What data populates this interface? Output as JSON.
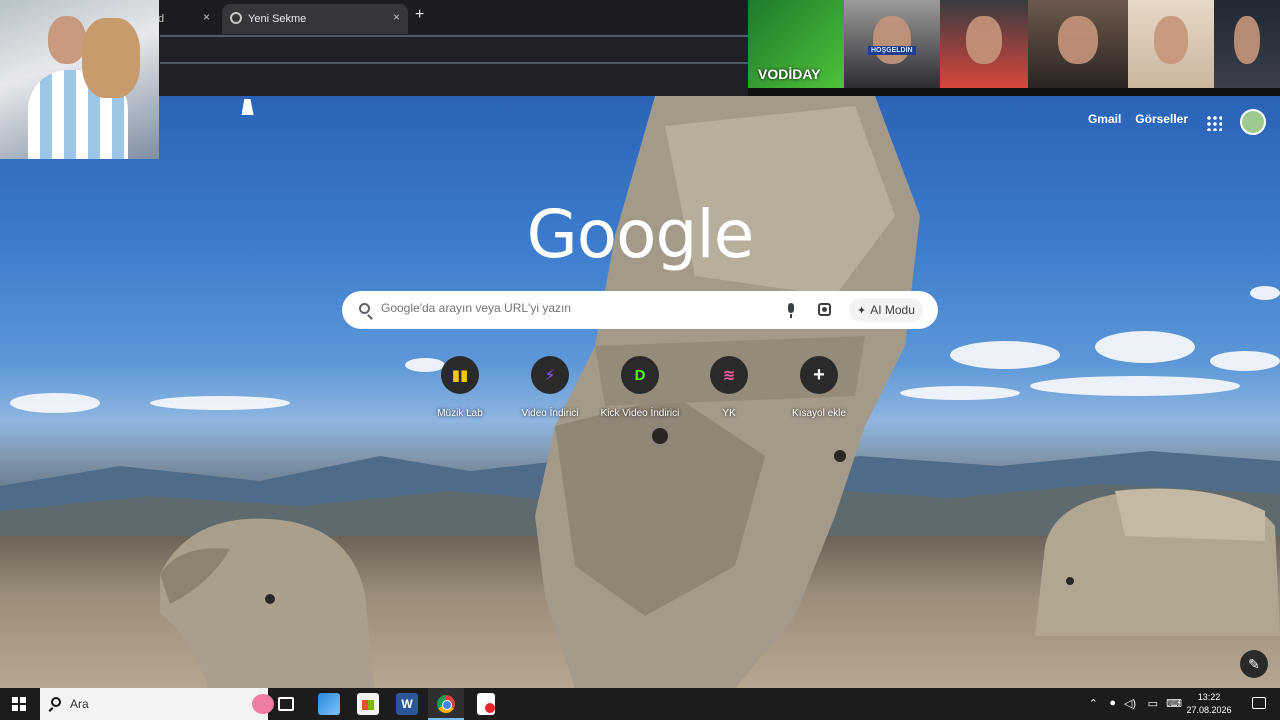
{
  "browser": {
    "tabs": [
      {
        "title": "d"
      },
      {
        "title": "Yeni Sekme"
      }
    ],
    "new_tab_label": "+",
    "close_glyph": "×"
  },
  "overlays": {
    "streamer_label": "VODİDAY",
    "banner_label": "HOŞGELDİN"
  },
  "google": {
    "header_links": [
      "Gmail",
      "Görseller"
    ],
    "logo": "Google",
    "search_placeholder": "Google'da arayın veya URL'yi yazın",
    "ai_mode_label": "AI Modu",
    "shortcuts": [
      {
        "label": "Müzik Lab",
        "glyph": "▮▮",
        "icon_color": "#f5c518",
        "icon": "music-lab-icon"
      },
      {
        "label": "Video İndirici",
        "glyph": "⚡",
        "icon_color": "#9b59ff",
        "icon": "lightning-icon"
      },
      {
        "label": "Kick Video İndirici",
        "glyph": "D",
        "icon_color": "#53fc18",
        "icon": "kick-icon"
      },
      {
        "label": "YK",
        "glyph": "≋",
        "icon_color": "#ff5fa2",
        "icon": "yk-icon"
      },
      {
        "label": "Kısayol ekle",
        "glyph": "+",
        "icon_color": "#ffffff",
        "icon": "add-icon"
      }
    ]
  },
  "taskbar": {
    "search_text": "Ara",
    "word_glyph": "W",
    "time": "13:22",
    "date": "27.08.2026",
    "tray_icons": [
      "chevron-up-icon",
      "microphone-icon",
      "speaker-icon",
      "network-icon",
      "keyboard-icon"
    ]
  },
  "colors": {
    "accent_taskbar": "#76b9ed",
    "chrome_dark": "#202124",
    "sky": "#3c7ccc"
  }
}
